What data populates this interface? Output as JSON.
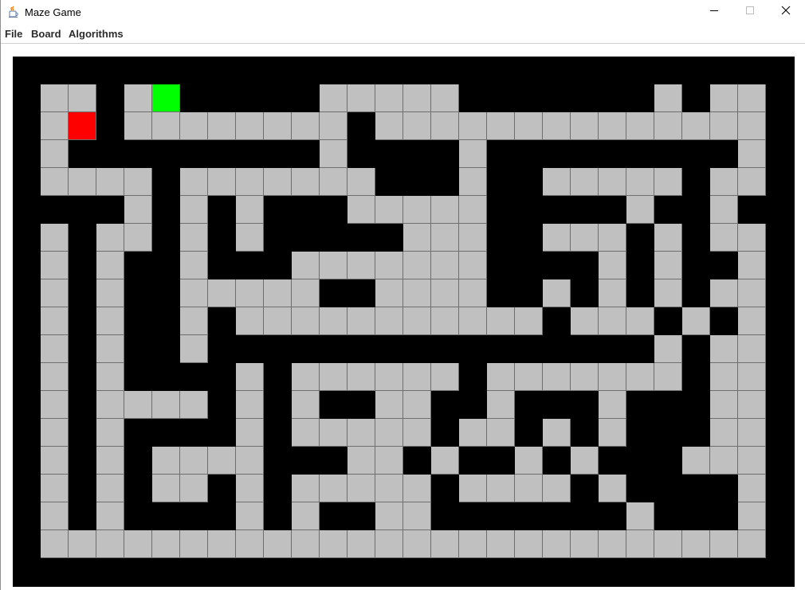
{
  "window": {
    "title": "Maze Game",
    "icon": "java-cup-icon"
  },
  "window_controls": {
    "minimize": "minimize-icon",
    "maximize": "maximize-icon",
    "close": "close-icon"
  },
  "menu": {
    "items": [
      "File",
      "Board",
      "Algorithms"
    ]
  },
  "maze": {
    "rows": 17,
    "cols": 26,
    "colors": {
      "wall": "#000000",
      "open": "#c0c0c0",
      "start": "#ff0000",
      "goal": "#00ff00",
      "cell_border": "#6e6e6e"
    },
    "grid": [
      "OO.OG.....OOOOO.......O.OO",
      "OS.OOOOOOOO.OOOOOOOOOOOOOO",
      "O.........O....O.........O",
      "OOOO.OOOOOOO...O..OOOOO.OO",
      "...O.O.O...OOOOO.....O..O.",
      "O.OO.O.O.....OOO..OOO.O.OO",
      "O.O..O...OOOOOOO....O.O..O",
      "O.O..OOOOO..OOOO..O.O.O.OO",
      "O.O..O.OOOOOOOOOOO.OOO.O.O",
      "O.O..O................O.OO",
      "O.O....O.OOOOOO.OOOOOOO.OO",
      "O.OOOO.O.O..OO..O...O...OO",
      "O.O....O.OOOOO.OO.O.O...OO",
      "O.O.OOOO...OO.O..O.O...OOO",
      "O.O.OO.O.OOOOO.OOOO.O....O",
      "O.O....O.O..OO.......O...O",
      "OOOOOOOOOOOOOOOOOOOOOOOOOO"
    ]
  }
}
